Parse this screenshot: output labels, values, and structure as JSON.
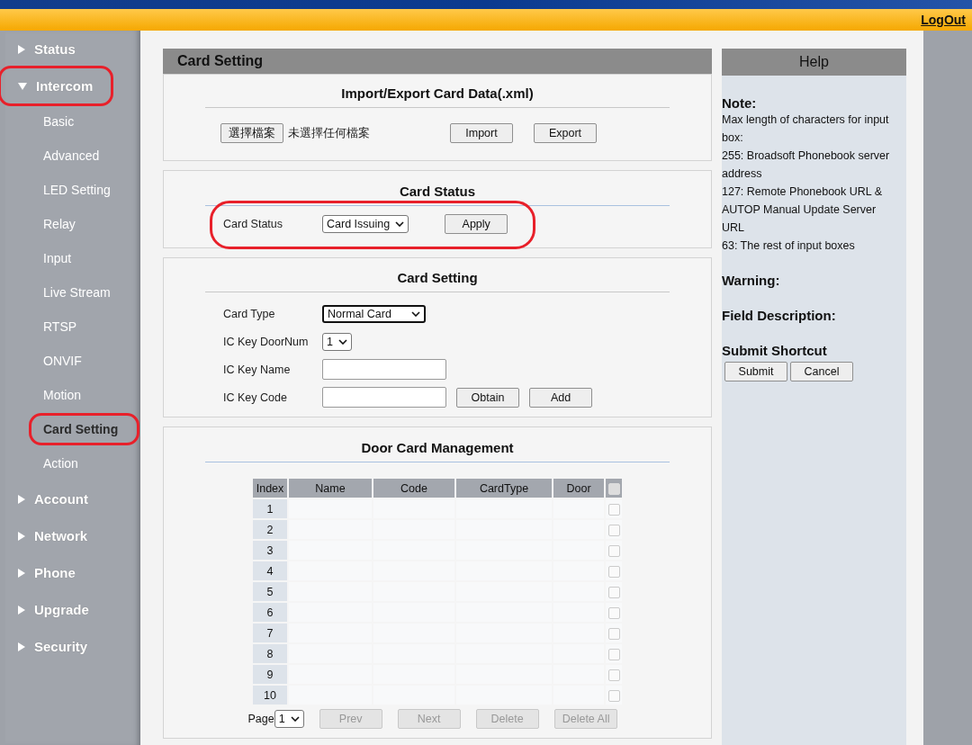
{
  "header": {
    "logout": "LogOut"
  },
  "sidebar": {
    "items": [
      {
        "label": "Status",
        "expanded": false,
        "highlighted": false
      },
      {
        "label": "Intercom",
        "expanded": true,
        "highlighted": true,
        "children": [
          {
            "label": "Basic",
            "selected": false,
            "highlighted": false
          },
          {
            "label": "Advanced",
            "selected": false,
            "highlighted": false
          },
          {
            "label": "LED Setting",
            "selected": false,
            "highlighted": false
          },
          {
            "label": "Relay",
            "selected": false,
            "highlighted": false
          },
          {
            "label": "Input",
            "selected": false,
            "highlighted": false
          },
          {
            "label": "Live Stream",
            "selected": false,
            "highlighted": false
          },
          {
            "label": "RTSP",
            "selected": false,
            "highlighted": false
          },
          {
            "label": "ONVIF",
            "selected": false,
            "highlighted": false
          },
          {
            "label": "Motion",
            "selected": false,
            "highlighted": false
          },
          {
            "label": "Card Setting",
            "selected": true,
            "highlighted": true
          },
          {
            "label": "Action",
            "selected": false,
            "highlighted": false
          }
        ]
      },
      {
        "label": "Account",
        "expanded": false,
        "highlighted": false
      },
      {
        "label": "Network",
        "expanded": false,
        "highlighted": false
      },
      {
        "label": "Phone",
        "expanded": false,
        "highlighted": false
      },
      {
        "label": "Upgrade",
        "expanded": false,
        "highlighted": false
      },
      {
        "label": "Security",
        "expanded": false,
        "highlighted": false
      }
    ]
  },
  "page": {
    "title": "Card Setting"
  },
  "import_export": {
    "heading": "Import/Export Card Data(.xml)",
    "file_button": "選擇檔案",
    "file_status": "未選擇任何檔案",
    "buttons": [
      "Import",
      "Export"
    ]
  },
  "card_status": {
    "heading": "Card Status",
    "label": "Card Status",
    "value": "Card Issuing",
    "button": "Apply",
    "highlighted": true
  },
  "card_setting": {
    "heading": "Card Setting",
    "fields": [
      {
        "kind": "select",
        "label": "Card Type",
        "value": "Normal Card",
        "focused": true
      },
      {
        "kind": "select",
        "label": "IC Key DoorNum",
        "value": "1",
        "focused": false
      },
      {
        "kind": "input",
        "label": "IC Key Name"
      },
      {
        "kind": "input",
        "label": "IC Key Code",
        "buttons": [
          "Obtain",
          "Add"
        ]
      }
    ]
  },
  "door_cards": {
    "heading": "Door Card Management",
    "columns": [
      "Index",
      "Name",
      "Code",
      "CardType",
      "Door"
    ],
    "select_all_checked": false,
    "rows": [
      {
        "index": "1",
        "checked": false
      },
      {
        "index": "2",
        "checked": false
      },
      {
        "index": "3",
        "checked": false
      },
      {
        "index": "4",
        "checked": false
      },
      {
        "index": "5",
        "checked": false
      },
      {
        "index": "6",
        "checked": false
      },
      {
        "index": "7",
        "checked": false
      },
      {
        "index": "8",
        "checked": false
      },
      {
        "index": "9",
        "checked": false
      },
      {
        "index": "10",
        "checked": false
      }
    ],
    "page_label": "Page",
    "page_value": "1",
    "buttons": [
      {
        "label": "Prev",
        "disabled": true
      },
      {
        "label": "Next",
        "disabled": true
      },
      {
        "label": "Delete",
        "disabled": true
      },
      {
        "label": "Delete All",
        "disabled": true
      }
    ]
  },
  "help": {
    "title": "Help",
    "note_heading": "Note:",
    "note_lines": [
      "Max length of characters for input box:",
      "255: Broadsoft Phonebook server address",
      "127: Remote Phonebook URL & AUTOP Manual Update Server URL",
      "63: The rest of input boxes"
    ],
    "warning_heading": "Warning:",
    "field_heading": "Field Description:",
    "submit_heading": "Submit Shortcut",
    "buttons": [
      "Submit",
      "Cancel"
    ]
  }
}
